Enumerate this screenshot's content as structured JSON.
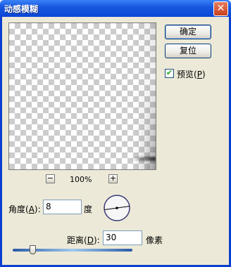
{
  "window": {
    "title": "动感模糊",
    "close_glyph": "✕"
  },
  "preview": {
    "zoom_level": "100%",
    "zoom_out_glyph": "−",
    "zoom_in_glyph": "+"
  },
  "buttons": {
    "ok": "确定",
    "reset": "复位"
  },
  "preview_checkbox": {
    "label_prefix": "预览(",
    "label_key": "P",
    "label_suffix": ")",
    "checked": true,
    "check_glyph": "✔"
  },
  "angle": {
    "label_prefix": "角度(",
    "label_key": "A",
    "label_suffix": "):",
    "value": "8",
    "unit": "度",
    "degrees": 8
  },
  "distance": {
    "label_prefix": "距离(",
    "label_key": "D",
    "label_suffix": "):",
    "value": "30",
    "unit": "像素",
    "slider_fraction": 0.06
  }
}
